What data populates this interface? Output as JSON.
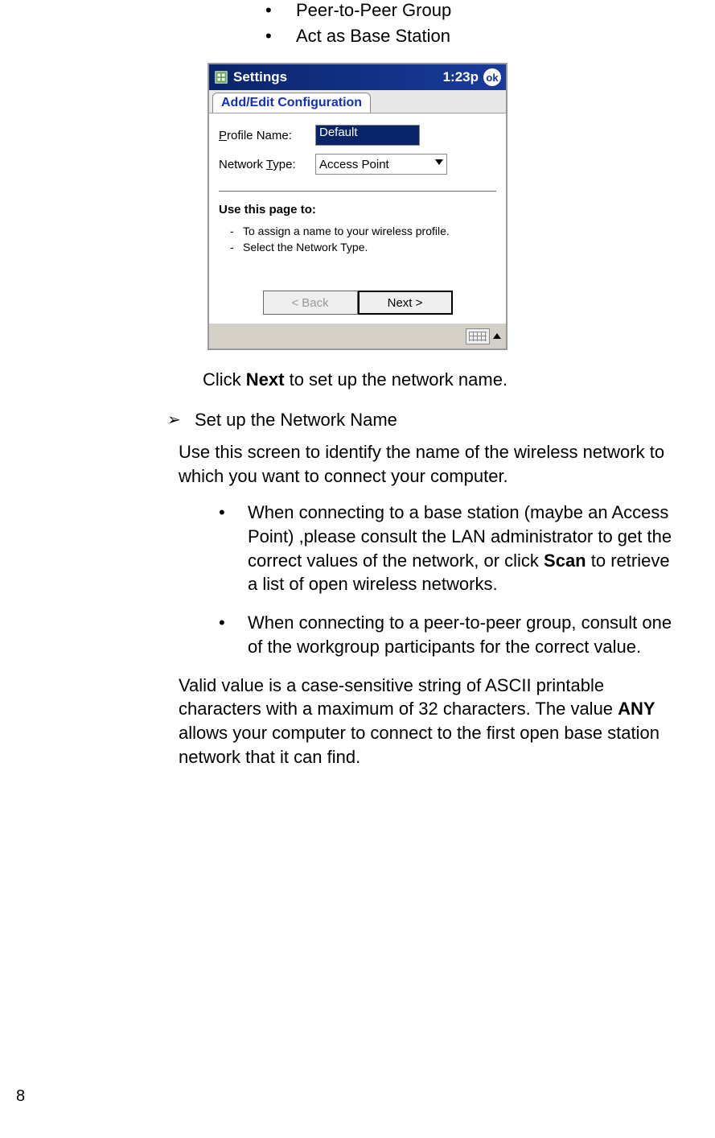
{
  "topBullets": {
    "item1": "Peer-to-Peer Group",
    "item2": "Act as Base Station"
  },
  "screenshot": {
    "titlebar": {
      "app": "Settings",
      "time": "1:23p",
      "ok": "ok"
    },
    "tab": "Add/Edit Configuration",
    "fields": {
      "profileLabelPrefix": "P",
      "profileLabelRest": "rofile Name:",
      "profileValue": "Default",
      "networkLabelPrefix": "Network ",
      "networkLabelU": "T",
      "networkLabelRest": "ype:",
      "networkValue": "Access Point"
    },
    "help": {
      "heading": "Use this page to:",
      "item1": "To assign a name to your wireless profile.",
      "item2": "Select the Network Type."
    },
    "buttons": {
      "back": "< Back",
      "next": "Next >"
    }
  },
  "caption": {
    "pre": "Click ",
    "bold": "Next",
    "post": " to set up the network name."
  },
  "section": {
    "heading": "Set up the Network Name"
  },
  "para1": "Use this screen to identify the name of the wireless network to which you want to connect your computer.",
  "bullet1": {
    "pre": "When connecting to a base station (maybe an Access Point) ,please consult the LAN administrator to get the correct values of the network, or click ",
    "bold": "Scan",
    "post": " to retrieve a list of open wireless networks."
  },
  "bullet2": "When connecting to a peer-to-peer group, consult one of the workgroup participants for the correct value.",
  "para2": {
    "pre": "Valid value is a case-sensitive string of ASCII printable characters with a maximum of 32 characters. The value ",
    "bold": "ANY",
    "post": " allows your computer to connect to the first open base station network that it can find."
  },
  "pageNumber": "8"
}
